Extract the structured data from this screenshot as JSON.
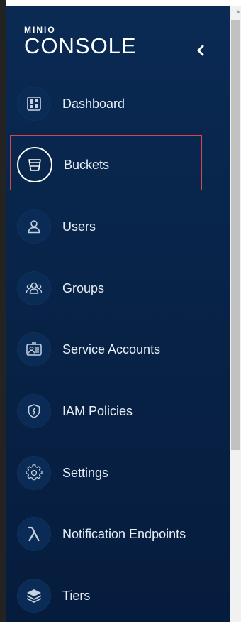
{
  "logo": {
    "top": "MINIO",
    "main": "CONSOLE"
  },
  "nav": {
    "items": [
      {
        "label": "Dashboard",
        "icon": "dashboard-icon"
      },
      {
        "label": "Buckets",
        "icon": "bucket-icon",
        "selected": true
      },
      {
        "label": "Users",
        "icon": "user-icon"
      },
      {
        "label": "Groups",
        "icon": "groups-icon"
      },
      {
        "label": "Service Accounts",
        "icon": "service-accounts-icon"
      },
      {
        "label": "IAM Policies",
        "icon": "iam-policies-icon"
      },
      {
        "label": "Settings",
        "icon": "gear-icon"
      },
      {
        "label": "Notification Endpoints",
        "icon": "lambda-icon"
      },
      {
        "label": "Tiers",
        "icon": "tiers-icon"
      }
    ]
  },
  "colors": {
    "sidebar_bg": "#082449",
    "text": "#e8eef6",
    "highlight": "#d9424f"
  }
}
